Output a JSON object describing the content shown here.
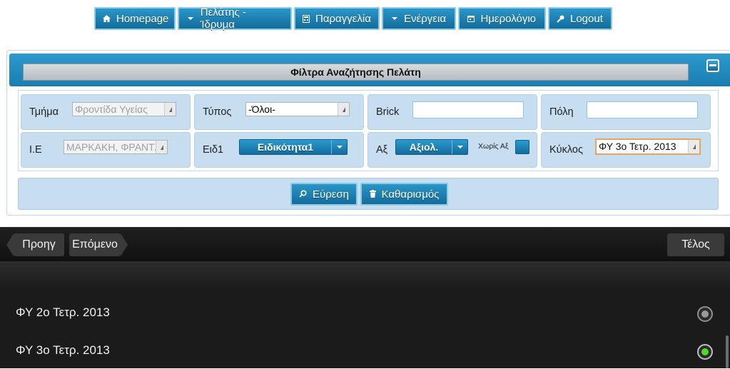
{
  "nav": {
    "items": [
      {
        "label": "Homepage",
        "icon": "home-icon"
      },
      {
        "label": "Πελάτης - Ίδρυμα",
        "icon": "chevron-down-icon"
      },
      {
        "label": "Παραγγελία",
        "icon": "calculator-icon"
      },
      {
        "label": "Ενέργεια",
        "icon": "chevron-down-icon"
      },
      {
        "label": "Ημερολόγιο",
        "icon": "calendar-icon"
      },
      {
        "label": "Logout",
        "icon": "key-icon"
      }
    ]
  },
  "filter_panel": {
    "title": "Φίλτρα Αναζήτησης Πελάτη",
    "tmima_label": "Τμήμα",
    "tmima_value": "Φροντίδα Υγείας",
    "typos_label": "Τύπος",
    "typos_value": "-Όλοι-",
    "brick_label": "Brick",
    "brick_value": "",
    "poli_label": "Πόλη",
    "poli_value": "",
    "ie_label": "Ι.Ε",
    "ie_value": "ΜΑΡΚΑΚΗ, ΦΡΑΝΤΖ",
    "eid1_label": "Ειδ1",
    "eid1_value": "Ειδικότητα1",
    "ax_label": "Αξ",
    "ax_value": "Αξιολ.",
    "xoris_ax_label": "Χωρίς Αξ",
    "kyklos_label": "Κύκλος",
    "kyklos_value": "ΦΥ 3ο Τετρ. 2013",
    "search_label": "Εύρεση",
    "clear_label": "Καθαρισμός"
  },
  "picker": {
    "prev_label": "Προηγ",
    "next_label": "Επόμενο",
    "done_label": "Τέλος",
    "options": [
      {
        "label": "ΦΥ 2ο Τετρ. 2013",
        "selected": false
      },
      {
        "label": "ΦΥ 3ο Τετρ. 2013",
        "selected": true
      }
    ]
  },
  "colors": {
    "accent_blue": "#1a7db0",
    "cell_bg": "#c6def0",
    "picker_bg": "#1b1b1b",
    "radio_selected": "#4bd92a"
  }
}
